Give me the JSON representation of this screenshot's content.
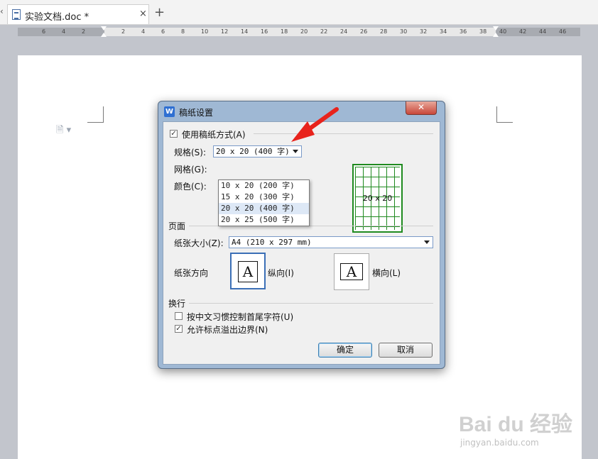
{
  "tabs": {
    "scroll_left": "‹",
    "active_title": "实验文档.doc *",
    "close_glyph": "×",
    "new_tab_glyph": "+"
  },
  "ruler": {
    "numbers_left": [
      "6",
      "4",
      "2"
    ],
    "numbers_right": [
      "2",
      "4",
      "6",
      "8",
      "10",
      "12",
      "14",
      "16",
      "18",
      "20",
      "22",
      "24",
      "26",
      "28",
      "30",
      "32",
      "34",
      "36",
      "38",
      "40",
      "42",
      "44",
      "46"
    ]
  },
  "dialog": {
    "title": "稿纸设置",
    "logo": "W",
    "close_glyph": "✕",
    "use_grid_paper": {
      "label": "使用稿纸方式(A)",
      "checked": true
    },
    "spec_label": "规格(S):",
    "spec_value": "20 x 20 (400 字)",
    "grid_label": "网格(G):",
    "color_label": "颜色(C):",
    "spec_options": [
      "10 x 20 (200 字)",
      "15 x 20 (300 字)",
      "20 x 20 (400 字)",
      "20 x 25 (500 字)"
    ],
    "spec_selected_index": 2,
    "preview_text": "20 x 20",
    "page_section": "页面",
    "paper_size_label": "纸张大小(Z):",
    "paper_size_value": "A4 (210 x 297 mm)",
    "orientation_label": "纸张方向",
    "portrait_label": "纵向(I)",
    "landscape_label": "横向(L)",
    "portrait_glyph": "A",
    "landscape_glyph": "A",
    "orientation_selected": "portrait",
    "wrap_section": "换行",
    "wrap_chinese": {
      "label": "按中文习惯控制首尾字符(U)",
      "checked": false
    },
    "allow_punct": {
      "label": "允许标点溢出边界(N)",
      "checked": true
    },
    "ok_label": "确定",
    "cancel_label": "取消"
  },
  "colors": {
    "annotation_arrow": "#e8231c",
    "grid_green": "#1f8a1f",
    "dialog_frame": "#9fb8d4"
  },
  "watermark": {
    "brand": "Bai du 经验",
    "url": "jingyan.baidu.com"
  }
}
